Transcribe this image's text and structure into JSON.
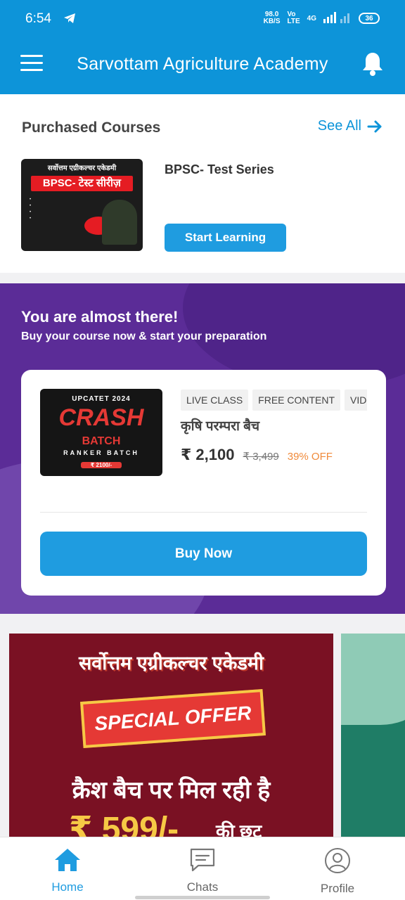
{
  "status": {
    "time": "6:54",
    "speed_value": "98.0",
    "speed_unit": "KB/S",
    "volte_top": "Vo",
    "volte_bottom": "LTE",
    "network": "4G",
    "battery": "36"
  },
  "appbar": {
    "title": "Sarvottam Agriculture Academy"
  },
  "purchased": {
    "title": "Purchased Courses",
    "see_all": "See All",
    "course": {
      "name": "BPSC- Test Series",
      "button": "Start Learning",
      "thumb_top": "सर्वोत्तम एग्रीकल्चर एकेडमी",
      "thumb_title": "BPSC- टेस्ट सीरीज़"
    }
  },
  "promo": {
    "heading": "You are almost there!",
    "subheading": "Buy your course now & start your preparation",
    "tags": [
      "LIVE CLASS",
      "FREE CONTENT",
      "VIDE"
    ],
    "batch_name": "कृषि परम्परा बैच",
    "price": "₹ 2,100",
    "old_price": "₹ 3,499",
    "discount": "39% OFF",
    "buy_button": "Buy Now",
    "thumb": {
      "line1": "UPCATET 2024",
      "line2": "CRASH",
      "line3": "BATCH",
      "line4": "RANKER BATCH",
      "line5": "₹ 2100/-"
    }
  },
  "banner": {
    "line1": "सर्वोत्तम एग्रीकल्चर एकेडमी",
    "ribbon": "SPECIAL OFFER",
    "line3": "क्रैश बैच पर मिल रही है",
    "amount": "₹ 599/-",
    "suffix": "की छट"
  },
  "bottom_nav": {
    "home": "Home",
    "chats": "Chats",
    "profile": "Profile"
  },
  "colors": {
    "primary": "#0d94d9",
    "button": "#1f9ce0",
    "promo_bg": "#5b2c97",
    "discount": "#f08a3a"
  }
}
